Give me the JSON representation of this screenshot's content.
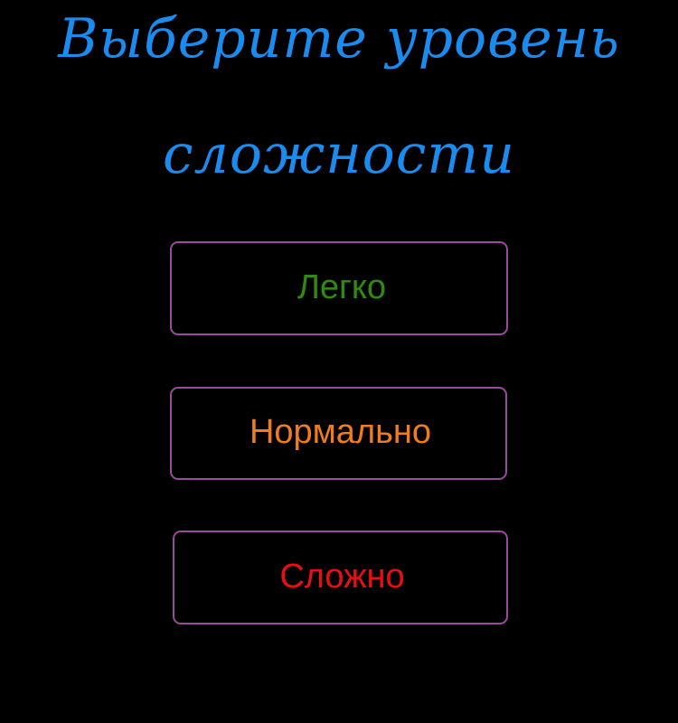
{
  "title": {
    "line1": "Выберите уровень",
    "line2": "сложности",
    "color": "#1a8cf0"
  },
  "buttons": {
    "easy": {
      "label": "Легко",
      "color": "#2e8b0e"
    },
    "normal": {
      "label": "Нормально",
      "color": "#f07d1a"
    },
    "hard": {
      "label": "Сложно",
      "color": "#e8100f"
    },
    "border_color": "#9a4a9e"
  },
  "background_color": "#000000"
}
